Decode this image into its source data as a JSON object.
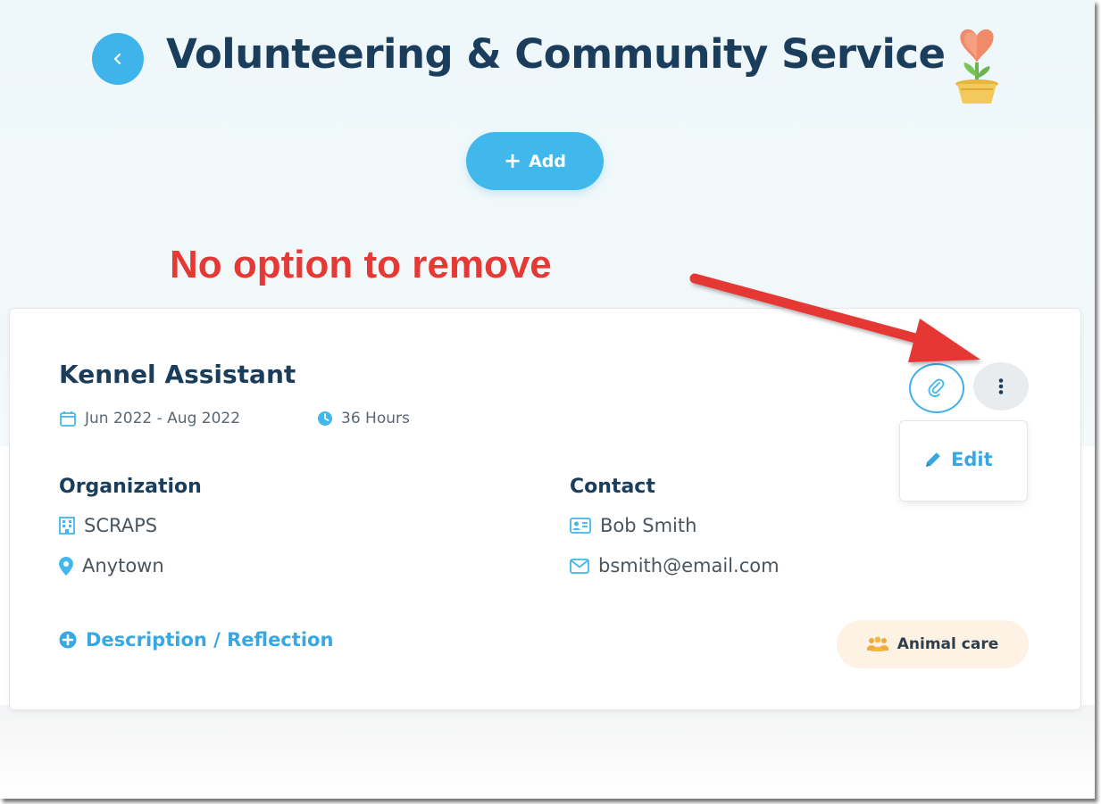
{
  "header": {
    "title": "Volunteering & Community Service",
    "add_label": "Add"
  },
  "annotation": {
    "text": "No option to remove",
    "color": "#e53935"
  },
  "entry": {
    "title": "Kennel Assistant",
    "dates": "Jun 2022 - Aug 2022",
    "hours": "36 Hours",
    "organization": {
      "heading": "Organization",
      "name": "SCRAPS",
      "location": "Anytown"
    },
    "contact": {
      "heading": "Contact",
      "name": "Bob Smith",
      "email": "bsmith@email.com"
    },
    "description_link": "Description / Reflection",
    "tag": "Animal care"
  },
  "menu": {
    "edit_label": "Edit"
  },
  "colors": {
    "accent": "#3fb4ea",
    "title": "#1b3d5c",
    "annotation": "#e53935",
    "tag_bg": "#fdf2e4"
  }
}
